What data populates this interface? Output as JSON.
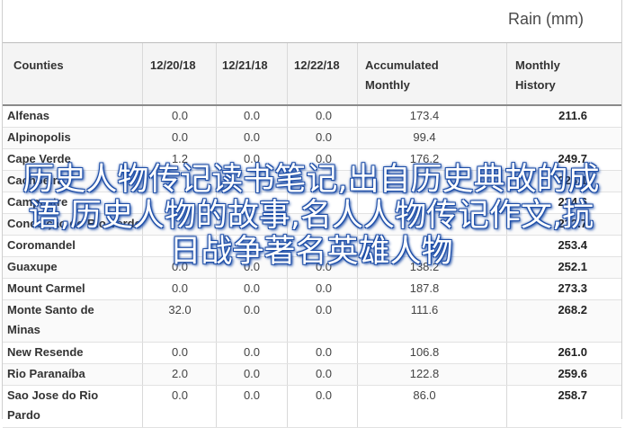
{
  "title": "Rain (mm)",
  "headers": {
    "counties": "Counties",
    "d1": "12/20/18",
    "d2": "12/21/18",
    "d3": "12/22/18",
    "accumulated": [
      "Accumulated",
      "Monthly"
    ],
    "monthly": [
      "Monthly",
      "History"
    ]
  },
  "rows": [
    {
      "name": [
        "Alfenas"
      ],
      "d1": "0.0",
      "d2": "0.0",
      "d3": "0.0",
      "acc": "173.4",
      "hist": "211.6"
    },
    {
      "name": [
        "Alpinopolis"
      ],
      "d1": "0.0",
      "d2": "0.0",
      "d3": "0.0",
      "acc": "99.4",
      "hist": ""
    },
    {
      "name": [
        "Cape Verde"
      ],
      "d1": "1.2",
      "d2": "0.0",
      "d3": "0.0",
      "acc": "176.2",
      "hist": "249.7"
    },
    {
      "name": [
        "Cachoeira"
      ],
      "d1": "",
      "d2": "",
      "d3": "",
      "acc": "",
      "hist": "226.1"
    },
    {
      "name": [
        "Campestre"
      ],
      "d1": "",
      "d2": "",
      "d3": "",
      "acc": "",
      "hist": "234.6"
    },
    {
      "name": [
        "Conceição do Rio Verde"
      ],
      "d1": "",
      "d2": "",
      "d3": "",
      "acc": "",
      "hist": "232.7"
    },
    {
      "name": [
        "Coromandel"
      ],
      "d1": "",
      "d2": "",
      "d3": "",
      "acc": "",
      "hist": "253.4"
    },
    {
      "name": [
        "Guaxupe"
      ],
      "d1": "0.0",
      "d2": "0.0",
      "d3": "0.0",
      "acc": "138.2",
      "hist": "252.1"
    },
    {
      "name": [
        "Mount Carmel"
      ],
      "d1": "0.0",
      "d2": "0.0",
      "d3": "0.0",
      "acc": "187.8",
      "hist": "273.3"
    },
    {
      "name": [
        "Monte Santo de",
        "Minas"
      ],
      "d1": "32.0",
      "d2": "0.0",
      "d3": "0.0",
      "acc": "111.6",
      "hist": "268.2"
    },
    {
      "name": [
        "New Resende"
      ],
      "d1": "0.0",
      "d2": "0.0",
      "d3": "0.0",
      "acc": "106.8",
      "hist": "261.0"
    },
    {
      "name": [
        "Rio Paranaíba"
      ],
      "d1": "2.0",
      "d2": "0.0",
      "d3": "0.0",
      "acc": "122.8",
      "hist": "259.6"
    },
    {
      "name": [
        "Sao Jose do Rio",
        "Pardo"
      ],
      "d1": "0.0",
      "d2": "0.0",
      "d3": "0.0",
      "acc": "86.0",
      "hist": "258.7"
    }
  ],
  "overlay_text": "历史人物传记读书笔记,出自历史典故的成语,历史人物的故事,名人人物传记作文,抗日战争著名英雄人物"
}
